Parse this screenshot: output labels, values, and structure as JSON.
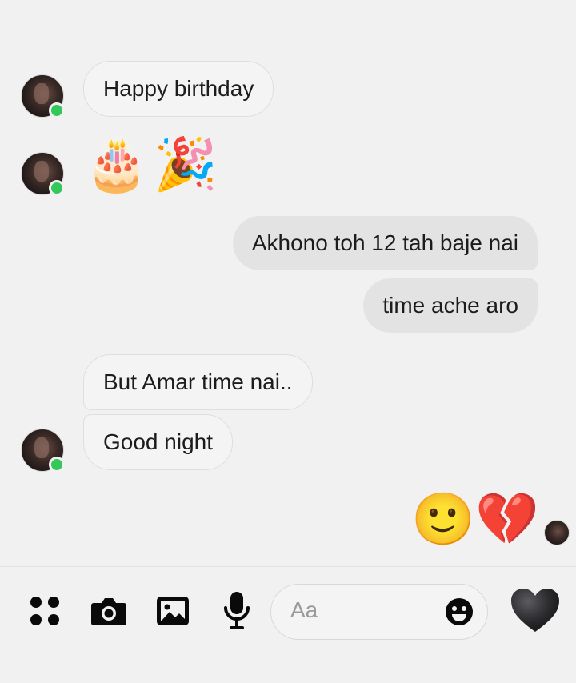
{
  "messages": {
    "m1": {
      "text": "Happy birthday"
    },
    "m2": {
      "emojis": [
        "🎂",
        "🎉"
      ]
    },
    "m3": {
      "text": "Akhono toh 12 tah baje nai"
    },
    "m4": {
      "text": "time ache aro"
    },
    "m5": {
      "text": "But Amar time nai.."
    },
    "m6": {
      "text": "Good night"
    },
    "m7": {
      "emojis": [
        "🙂",
        "💔"
      ]
    }
  },
  "composer": {
    "placeholder": "Aa",
    "icons": [
      "apps-icon",
      "camera-icon",
      "gallery-icon",
      "microphone-icon",
      "smiley-icon",
      "heart-icon"
    ],
    "heart_color": "#2b2b2e"
  },
  "colors": {
    "online": "#34c759",
    "incoming_bubble": "#f4f4f4",
    "outgoing_bubble": "#e3e3e3"
  }
}
